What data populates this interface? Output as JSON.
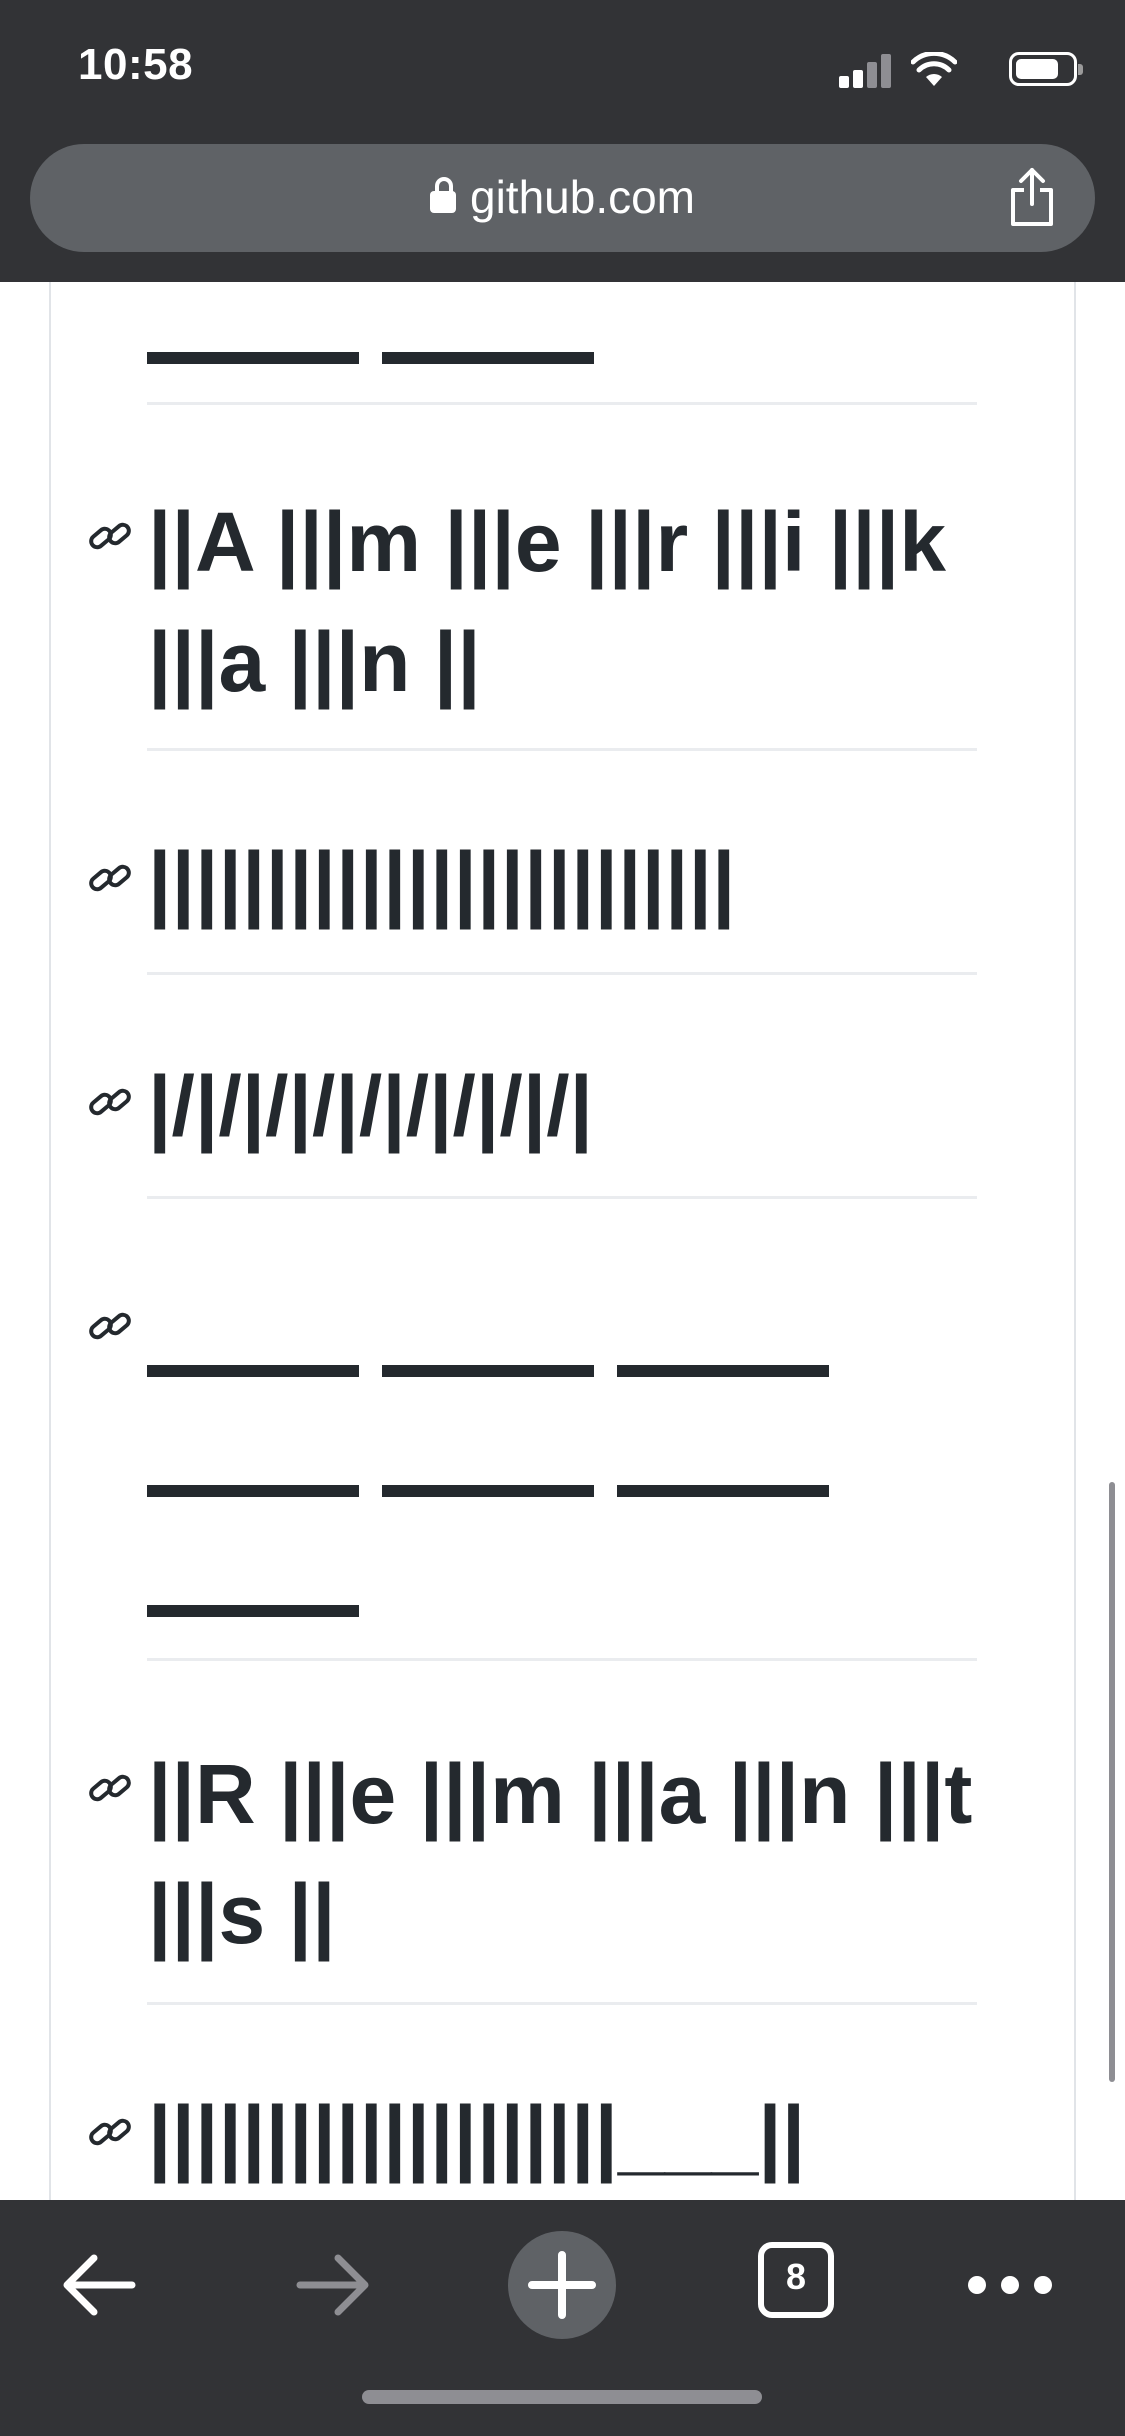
{
  "status_bar": {
    "time": "10:58",
    "icons": [
      "cellular-signal-icon",
      "wifi-icon",
      "battery-icon"
    ]
  },
  "address_bar": {
    "url": "github.com",
    "lock_icon": "lock-icon",
    "share_icon": "share-icon"
  },
  "content": {
    "headings": [
      {
        "text": "||A |||m |||e |||r |||i |||k |||a |||n ||"
      },
      {
        "text": "|||||||||||||||||||||||||"
      },
      {
        "text": "|/|/|/|/|/|/|/|/|/|"
      },
      {
        "text": "",
        "dash_count": 7
      },
      {
        "text": "||R |||e |||m |||a |||n |||t |||s ||"
      },
      {
        "text": "||||||||||||||||||||___||"
      }
    ]
  },
  "toolbar": {
    "back": "back-arrow-icon",
    "forward": "forward-arrow-icon",
    "new_tab": "plus-icon",
    "tab_count": "8",
    "more": "more-dots-icon"
  },
  "colors": {
    "chrome_background": "#323336",
    "url_pill": "#5f6266",
    "text": "#24292e",
    "divider": "#eaecef"
  }
}
